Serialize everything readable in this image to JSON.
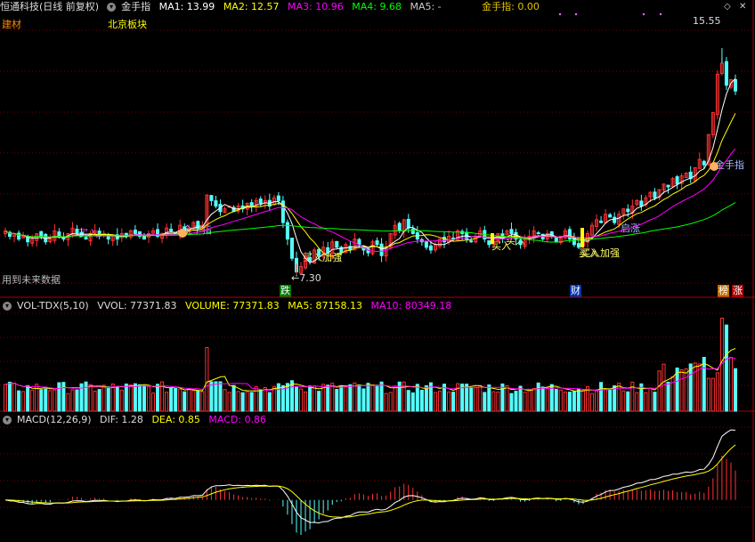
{
  "header": {
    "stock_name": "恒通科技(日线 前复权)",
    "indicator_name": "金手指",
    "ma1_label": "MA1: 13.99",
    "ma2_label": "MA2: 12.57",
    "ma3_label": "MA3: 10.96",
    "ma4_label": "MA4: 9.68",
    "ma5_label": "MA5: -",
    "jsz_label": "金手指: 0.00"
  },
  "price_panel": {
    "sector1": "建材",
    "sector2": "北京板块",
    "high_label": "15.55",
    "low_label": "←7.30",
    "future_data_note": "用到未来数据",
    "signals": [
      {
        "text": "买入"
      },
      {
        "text": "金手指"
      },
      {
        "text": "买入加强"
      },
      {
        "text": "买入"
      },
      {
        "text": "买入"
      },
      {
        "text": "买入"
      },
      {
        "text": "买入加强"
      },
      {
        "text": "启涨"
      },
      {
        "text": "金手指"
      }
    ],
    "markers": {
      "fall": "跌",
      "finance": "财",
      "rank": "榜",
      "rise": "涨"
    }
  },
  "volume_panel": {
    "title": "VOL-TDX(5,10)",
    "vvol": "VVOL: 77371.83",
    "volume": "VOLUME: 77371.83",
    "ma5": "MA5: 87158.13",
    "ma10": "MA10: 80349.18"
  },
  "macd_panel": {
    "title": "MACD(12,26,9)",
    "dif": "DIF: 1.28",
    "dea": "DEA: 0.85",
    "macd": "MACD: 0.86"
  },
  "colors": {
    "up": "#ff3232",
    "down": "#54ffff",
    "ma1": "#ffffff",
    "ma2": "#ffff00",
    "ma3": "#ff00ff",
    "ma4": "#00ff00",
    "grid": "#7a0000"
  },
  "chart_data": {
    "type": "candlestick",
    "closes": [
      8.9,
      8.7,
      8.8,
      8.6,
      8.7,
      8.5,
      8.6,
      8.8,
      8.7,
      8.5,
      8.6,
      8.9,
      8.7,
      8.6,
      8.8,
      9.0,
      8.8,
      8.7,
      8.6,
      8.8,
      8.9,
      8.7,
      8.8,
      8.6,
      8.7,
      8.6,
      8.8,
      8.7,
      8.9,
      8.8,
      8.7,
      8.6,
      8.8,
      8.9,
      8.7,
      8.8,
      9.0,
      8.9,
      8.8,
      9.1,
      8.9,
      9.0,
      9.2,
      9.0,
      9.1,
      10.2,
      10.0,
      9.8,
      9.6,
      9.7,
      9.8,
      9.6,
      9.8,
      9.7,
      9.9,
      9.8,
      10.0,
      9.9,
      10.0,
      9.8,
      10.1,
      10.0,
      9.2,
      8.6,
      7.9,
      7.4,
      7.6,
      8.0,
      7.8,
      8.2,
      8.0,
      8.3,
      8.1,
      8.5,
      8.3,
      8.1,
      8.4,
      8.2,
      8.6,
      8.4,
      8.2,
      8.1,
      8.5,
      8.4,
      8.0,
      8.3,
      8.8,
      9.1,
      8.9,
      9.3,
      9.0,
      8.8,
      8.6,
      8.5,
      8.3,
      8.2,
      8.4,
      8.6,
      8.5,
      8.7,
      8.6,
      8.9,
      8.8,
      8.6,
      8.5,
      8.7,
      8.9,
      8.6,
      8.4,
      8.6,
      8.8,
      8.7,
      8.9,
      8.8,
      8.6,
      8.4,
      8.6,
      8.7,
      8.9,
      8.8,
      8.6,
      8.8,
      8.7,
      8.5,
      8.7,
      8.9,
      8.6,
      8.4,
      8.3,
      8.5,
      8.8,
      9.1,
      9.3,
      9.2,
      9.5,
      9.4,
      9.2,
      9.5,
      9.7,
      9.6,
      9.8,
      10.0,
      9.8,
      10.1,
      10.3,
      10.1,
      10.4,
      10.6,
      10.5,
      10.8,
      10.6,
      10.9,
      11.0,
      10.8,
      11.2,
      11.5,
      11.3,
      12.4,
      13.2,
      14.6,
      15.0,
      14.2,
      14.4,
      13.99
    ],
    "low_marker": 7.3,
    "high_marker": 15.55,
    "ylim": [
      7.0,
      16.2
    ]
  }
}
